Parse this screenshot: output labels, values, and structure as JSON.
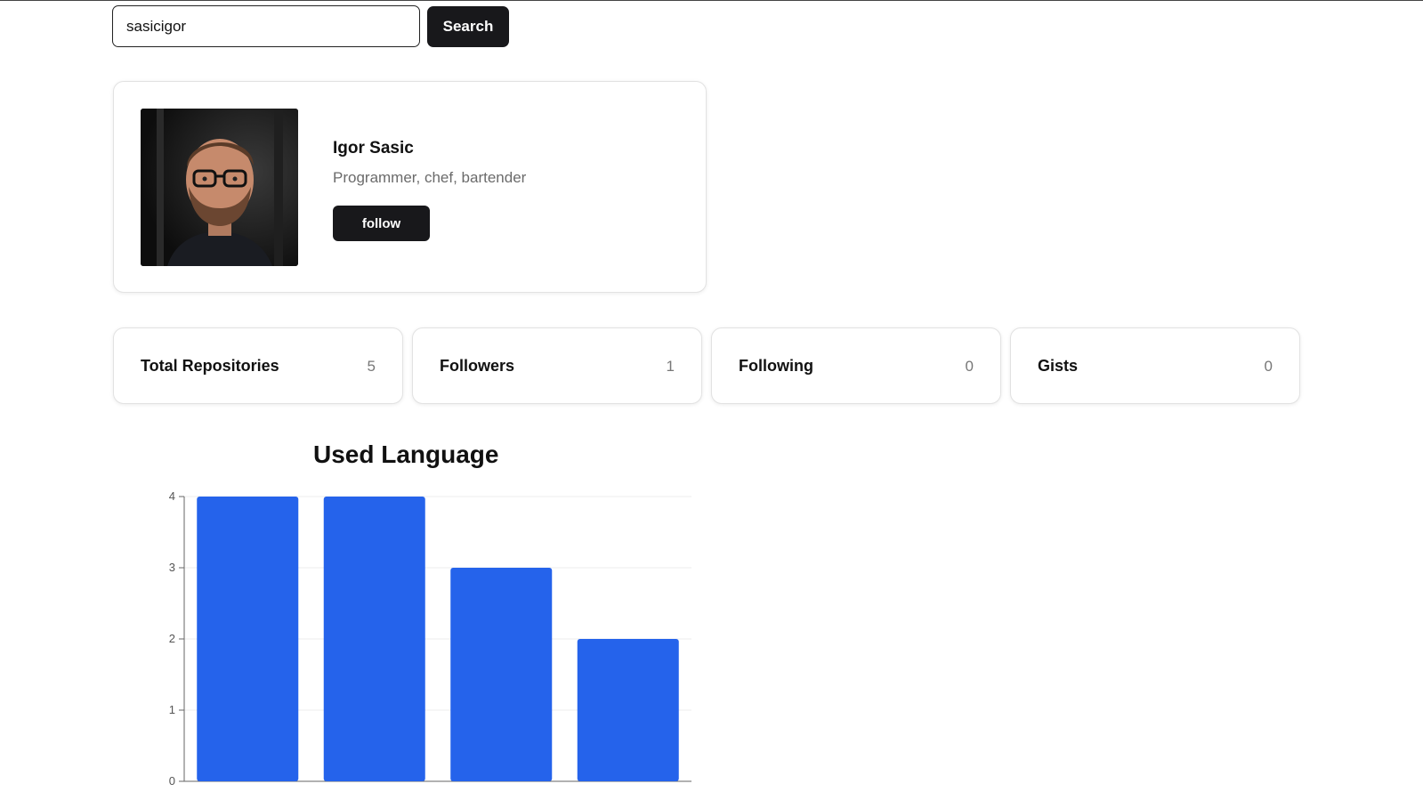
{
  "search": {
    "value": "sasicigor",
    "button_label": "Search"
  },
  "profile": {
    "name": "Igor Sasic",
    "bio": "Programmer, chef, bartender",
    "follow_label": "follow"
  },
  "stats": [
    {
      "label": "Total Repositories",
      "value": "5"
    },
    {
      "label": "Followers",
      "value": "1"
    },
    {
      "label": "Following",
      "value": "0"
    },
    {
      "label": "Gists",
      "value": "0"
    }
  ],
  "colors": {
    "accent_dark": "#18181b",
    "bar": "#2563eb"
  },
  "chart_data": {
    "type": "bar",
    "title": "Used Language",
    "categories": [
      "",
      "",
      "",
      ""
    ],
    "values": [
      4,
      4,
      3,
      2
    ],
    "ylim": [
      0,
      4
    ],
    "yticks": [
      0,
      1,
      2,
      3,
      4
    ],
    "grid": true,
    "color": "#2563eb"
  }
}
